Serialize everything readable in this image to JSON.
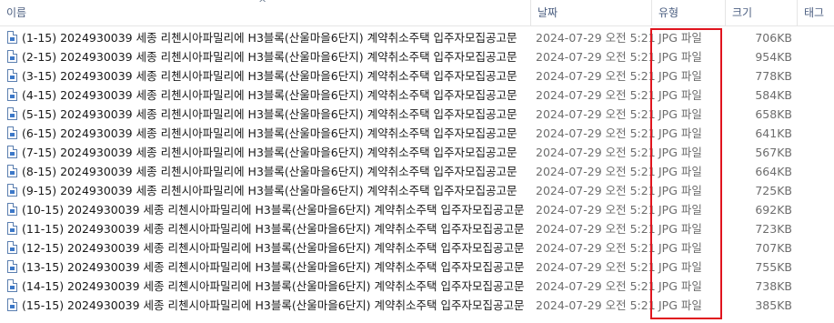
{
  "columns": {
    "name": "이름",
    "date": "날짜",
    "type": "유형",
    "size": "크기",
    "tags": "태그"
  },
  "sort_indicator": "^",
  "files": [
    {
      "name": "(1-15) 2024930039 세종 리첸시아파밀리에 H3블록(산울마을6단지) 계약취소주택 입주자모집공고문",
      "date": "2024-07-29 오전 5:21",
      "type": "JPG 파일",
      "size": "706KB"
    },
    {
      "name": "(2-15) 2024930039 세종 리첸시아파밀리에 H3블록(산울마을6단지) 계약취소주택 입주자모집공고문",
      "date": "2024-07-29 오전 5:21",
      "type": "JPG 파일",
      "size": "954KB"
    },
    {
      "name": "(3-15) 2024930039 세종 리첸시아파밀리에 H3블록(산울마을6단지) 계약취소주택 입주자모집공고문",
      "date": "2024-07-29 오전 5:21",
      "type": "JPG 파일",
      "size": "778KB"
    },
    {
      "name": "(4-15) 2024930039 세종 리첸시아파밀리에 H3블록(산울마을6단지) 계약취소주택 입주자모집공고문",
      "date": "2024-07-29 오전 5:21",
      "type": "JPG 파일",
      "size": "584KB"
    },
    {
      "name": "(5-15) 2024930039 세종 리첸시아파밀리에 H3블록(산울마을6단지) 계약취소주택 입주자모집공고문",
      "date": "2024-07-29 오전 5:21",
      "type": "JPG 파일",
      "size": "658KB"
    },
    {
      "name": "(6-15) 2024930039 세종 리첸시아파밀리에 H3블록(산울마을6단지) 계약취소주택 입주자모집공고문",
      "date": "2024-07-29 오전 5:21",
      "type": "JPG 파일",
      "size": "641KB"
    },
    {
      "name": "(7-15) 2024930039 세종 리첸시아파밀리에 H3블록(산울마을6단지) 계약취소주택 입주자모집공고문",
      "date": "2024-07-29 오전 5:21",
      "type": "JPG 파일",
      "size": "567KB"
    },
    {
      "name": "(8-15) 2024930039 세종 리첸시아파밀리에 H3블록(산울마을6단지) 계약취소주택 입주자모집공고문",
      "date": "2024-07-29 오전 5:21",
      "type": "JPG 파일",
      "size": "664KB"
    },
    {
      "name": "(9-15) 2024930039 세종 리첸시아파밀리에 H3블록(산울마을6단지) 계약취소주택 입주자모집공고문",
      "date": "2024-07-29 오전 5:21",
      "type": "JPG 파일",
      "size": "725KB"
    },
    {
      "name": "(10-15) 2024930039 세종 리첸시아파밀리에 H3블록(산울마을6단지) 계약취소주택 입주자모집공고문",
      "date": "2024-07-29 오전 5:21",
      "type": "JPG 파일",
      "size": "692KB"
    },
    {
      "name": "(11-15) 2024930039 세종 리첸시아파밀리에 H3블록(산울마을6단지) 계약취소주택 입주자모집공고문",
      "date": "2024-07-29 오전 5:21",
      "type": "JPG 파일",
      "size": "723KB"
    },
    {
      "name": "(12-15) 2024930039 세종 리첸시아파밀리에 H3블록(산울마을6단지) 계약취소주택 입주자모집공고문",
      "date": "2024-07-29 오전 5:21",
      "type": "JPG 파일",
      "size": "707KB"
    },
    {
      "name": "(13-15) 2024930039 세종 리첸시아파밀리에 H3블록(산울마을6단지) 계약취소주택 입주자모집공고문",
      "date": "2024-07-29 오전 5:21",
      "type": "JPG 파일",
      "size": "755KB"
    },
    {
      "name": "(14-15) 2024930039 세종 리첸시아파밀리에 H3블록(산울마을6단지) 계약취소주택 입주자모집공고문",
      "date": "2024-07-29 오전 5:21",
      "type": "JPG 파일",
      "size": "738KB"
    },
    {
      "name": "(15-15) 2024930039 세종 리첸시아파밀리에 H3블록(산울마을6단지) 계약취소주택 입주자모집공고문",
      "date": "2024-07-29 오전 5:21",
      "type": "JPG 파일",
      "size": "385KB"
    }
  ],
  "icons": {
    "file": "image-file-icon",
    "sort": "sort-ascending-icon"
  },
  "colors": {
    "highlight": "#e0141e",
    "header_text": "#4d6082",
    "secondary_text": "#6d6d6d"
  }
}
